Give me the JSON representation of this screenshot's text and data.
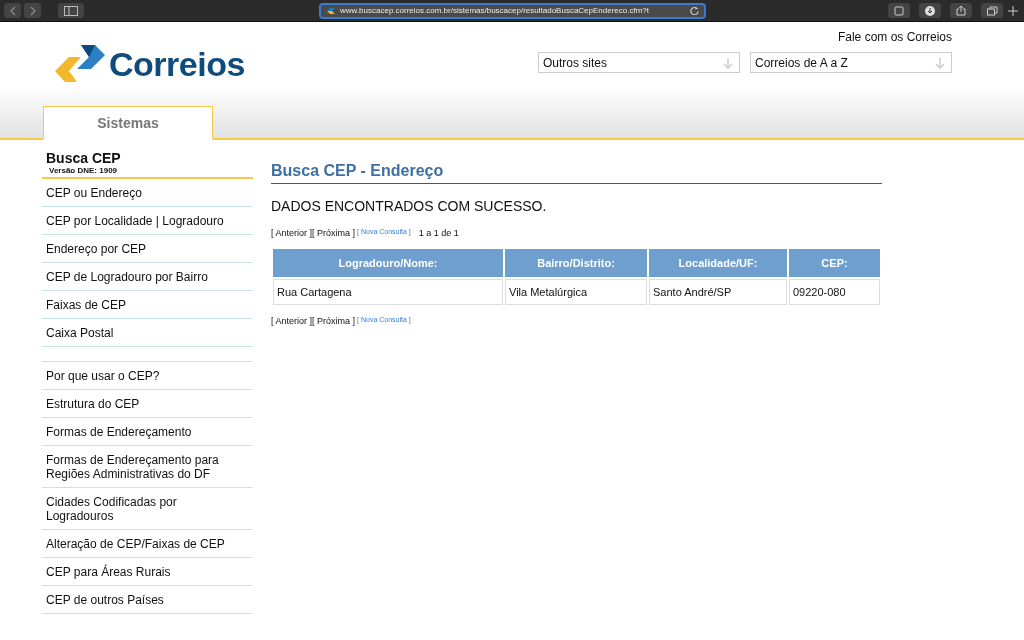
{
  "browser": {
    "url": "www.buscacep.correios.com.br/sistemas/buscacep/resultadoBuscaCepEndereco.cfm?t"
  },
  "header": {
    "logo": "Correios",
    "contact_link": "Fale com os Correios",
    "dropdowns": [
      "Outros sites",
      "Correios de A a Z"
    ]
  },
  "tabs": [
    {
      "label": "Sistemas",
      "selected": true
    }
  ],
  "sidebar": {
    "title": "Busca CEP",
    "subtitle": "Versão DNE: 1909",
    "groups": [
      [
        "CEP ou Endereço",
        "CEP por Localidade | Logradouro",
        "Endereço por CEP",
        "CEP de Logradouro por Bairro",
        "Faixas de CEP",
        "Caixa Postal"
      ],
      [
        "Por que usar o CEP?",
        "Estrutura do CEP",
        "Formas de Endereçamento",
        "Formas de Endereçamento para Regiões Administrativas do DF",
        "Cidades Codificadas por Logradouros",
        "Alteração de CEP/Faixas de CEP",
        "CEP para Áreas Rurais",
        "CEP de outros Países"
      ]
    ]
  },
  "content": {
    "title": "Busca CEP - Endereço",
    "message": "DADOS ENCONTRADOS COM SUCESSO.",
    "pager_top": {
      "previous": "[ Anterior ]",
      "next": "[ Próxima ]",
      "new_search": "[ Nova Consulta ]",
      "count": "1 a 1 de 1"
    },
    "table": {
      "columns": [
        "Logradouro/Nome:",
        "Bairro/Distrito:",
        "Localidade/UF:",
        "CEP:"
      ],
      "rows": [
        [
          "Rua Cartagena",
          "Vila Metalúrgica",
          "Santo André/SP",
          "09220-080"
        ]
      ]
    },
    "pager_bottom": {
      "previous": "[ Anterior ]",
      "next": "[ Próxima ]",
      "new_search": "[ Nova Consulta ]"
    }
  }
}
